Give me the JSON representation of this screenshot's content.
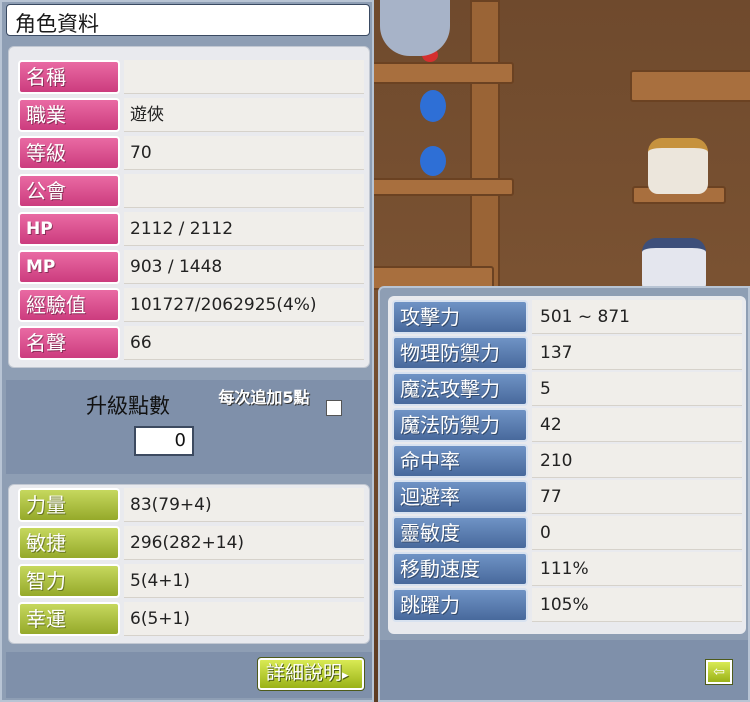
{
  "window": {
    "title": "角色資料"
  },
  "profile": [
    {
      "label": "名稱",
      "value": ""
    },
    {
      "label": "職業",
      "value": "遊俠"
    },
    {
      "label": "等級",
      "value": "70"
    },
    {
      "label": "公會",
      "value": ""
    },
    {
      "label": "HP",
      "value": "2112 / 2112"
    },
    {
      "label": "MP",
      "value": "903 / 1448"
    },
    {
      "label": "經驗值",
      "value": "101727/2062925(4%)"
    },
    {
      "label": "名聲",
      "value": "66"
    }
  ],
  "ability_points": {
    "label": "升級點數",
    "value": "0",
    "each_add_label": "每次追加5點",
    "each_add_checked": false
  },
  "base_stats": [
    {
      "label": "力量",
      "value": "83(79+4)"
    },
    {
      "label": "敏捷",
      "value": "296(282+14)"
    },
    {
      "label": "智力",
      "value": "5(4+1)"
    },
    {
      "label": "幸運",
      "value": "6(5+1)"
    }
  ],
  "detail_button": {
    "label": "詳細說明",
    "arrow": "▸"
  },
  "detail_stats": [
    {
      "label": "攻擊力",
      "value": "501 ~ 871"
    },
    {
      "label": "物理防禦力",
      "value": "137"
    },
    {
      "label": "魔法攻擊力",
      "value": "5"
    },
    {
      "label": "魔法防禦力",
      "value": "42"
    },
    {
      "label": "命中率",
      "value": "210"
    },
    {
      "label": "迴避率",
      "value": "77"
    },
    {
      "label": "靈敏度",
      "value": "0"
    },
    {
      "label": "移動速度",
      "value": "111%"
    },
    {
      "label": "跳躍力",
      "value": "105%"
    }
  ],
  "back_button": {
    "icon": "arrow-left-icon",
    "glyph": "⇦"
  },
  "colors": {
    "profile_label": "#d94a8c",
    "stat_label": "#a8bc36",
    "detail_label": "#5a7db3",
    "panel": "#8e9eb4"
  }
}
